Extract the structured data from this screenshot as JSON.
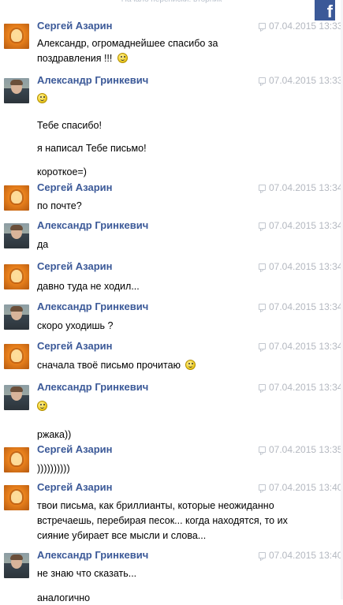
{
  "header": {
    "label": "Начало переписки: вторник"
  },
  "brand": {
    "logo_letter": "f",
    "color": "#3b5998"
  },
  "messages": [
    {
      "author": "Сергей Азарин",
      "avatar": "sergey",
      "time": "07.04.2015 13:33",
      "lines": [
        "Александр, огромаднейшее спасибо за",
        "поздравления !!! "
      ],
      "smile_line": 1
    },
    {
      "author": "Александр Гринкевич",
      "avatar": "alex",
      "time": "07.04.2015 13:33",
      "lines": [
        "",
        "Тебе спасибо!",
        "я написал Тебе письмо!",
        "короткое=)"
      ],
      "smile_line": 0
    },
    {
      "author": "Сергей Азарин",
      "avatar": "sergey",
      "time": "07.04.2015 13:34",
      "lines": [
        "по почте?"
      ]
    },
    {
      "author": "Александр Гринкевич",
      "avatar": "alex",
      "time": "07.04.2015 13:34",
      "lines": [
        "да"
      ]
    },
    {
      "author": "Сергей Азарин",
      "avatar": "sergey",
      "time": "07.04.2015 13:34",
      "lines": [
        "давно туда не ходил..."
      ]
    },
    {
      "author": "Александр Гринкевич",
      "avatar": "alex",
      "time": "07.04.2015 13:34",
      "lines": [
        "скоро уходишь ?"
      ]
    },
    {
      "author": "Сергей Азарин",
      "avatar": "sergey",
      "time": "07.04.2015 13:34",
      "lines": [
        "сначала твоё письмо прочитаю "
      ],
      "smile_line": 0
    },
    {
      "author": "Александр Гринкевич",
      "avatar": "alex",
      "time": "07.04.2015 13:34",
      "lines": [
        "",
        "ржака))"
      ],
      "smile_line": 0
    },
    {
      "author": "Сергей Азарин",
      "avatar": "sergey",
      "time": "07.04.2015 13:35",
      "lines": [
        "))))))))))"
      ]
    },
    {
      "author": "Сергей Азарин",
      "avatar": "sergey",
      "time": "07.04.2015 13:40",
      "lines": [
        "твои письма, как бриллианты, которые неожиданно",
        "встречаешь, перебирая песок... когда находятся, то их",
        "сияние убирает все мысли и слова..."
      ]
    },
    {
      "author": "Александр Гринкевич",
      "avatar": "alex",
      "time": "07.04.2015 13:40",
      "lines": [
        "не знаю что сказать...",
        "аналогично"
      ]
    }
  ]
}
